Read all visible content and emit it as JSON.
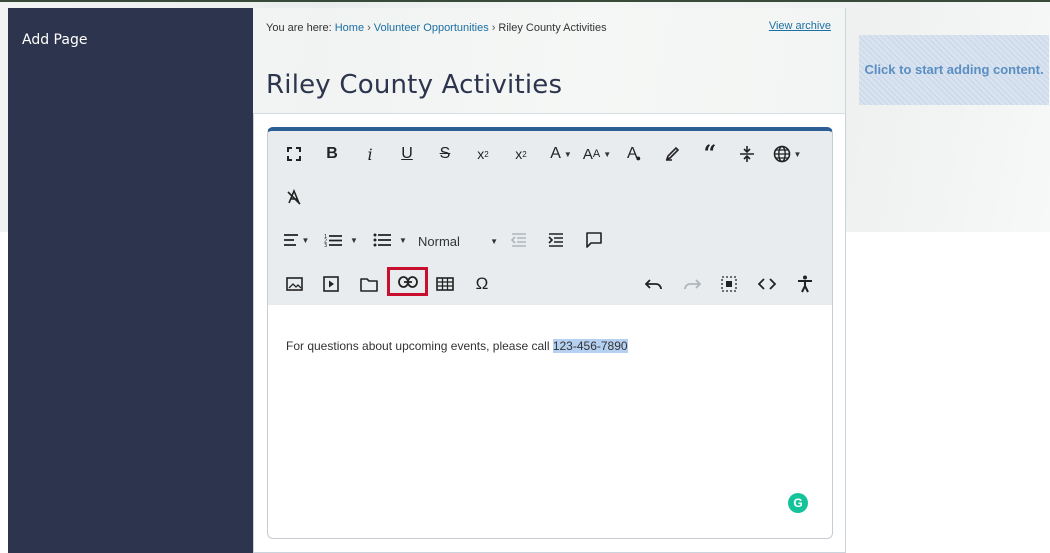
{
  "sidebar": {
    "title": "Add Page"
  },
  "breadcrumb": {
    "prefix": "You are here:",
    "items": [
      "Home",
      "Volunteer Opportunities",
      "Riley County Activities"
    ],
    "separator": "›"
  },
  "view_archive": "View archive",
  "page_title": "Riley County Activities",
  "toolbar": {
    "format_select": "Normal",
    "icons_row1": [
      "fullscreen-icon",
      "bold-icon",
      "italic-icon",
      "underline-icon",
      "strikethrough-icon",
      "subscript-icon",
      "superscript-icon",
      "font-color-icon",
      "font-size-icon",
      "background-color-icon",
      "highlighter-icon",
      "blockquote-icon",
      "page-break-icon",
      "language-icon"
    ],
    "icons_row2": [
      "clear-formatting-icon"
    ],
    "icons_row3": [
      "align-icon",
      "numbered-list-icon",
      "bulleted-list-icon",
      "outdent-icon",
      "indent-icon",
      "comment-icon"
    ],
    "icons_row4": [
      "image-icon",
      "video-icon",
      "folder-icon",
      "link-icon",
      "table-icon",
      "special-character-icon",
      "undo-icon",
      "redo-icon",
      "select-all-icon",
      "source-code-icon",
      "accessibility-icon"
    ]
  },
  "editor": {
    "text_before": "For questions about upcoming events, please call ",
    "selected_text": "123-456-7890"
  },
  "grammarly_letter": "G",
  "add_content_label": "Click to start adding content.",
  "colors": {
    "sidebar": "#2c354d",
    "accent_border": "#2b5f94",
    "highlight": "#c8102e",
    "link": "#1c6fa3",
    "selection": "#b5d0f0"
  }
}
